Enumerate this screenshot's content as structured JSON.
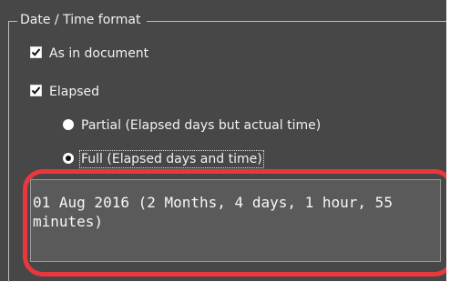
{
  "group": {
    "title": "Date / Time format"
  },
  "options": {
    "as_in_document": {
      "label": "As in document",
      "checked": true
    },
    "elapsed": {
      "label": "Elapsed",
      "checked": true
    },
    "partial": {
      "label": "Partial (Elapsed days but actual time)",
      "selected": false
    },
    "full": {
      "label": "Full (Elapsed days and time)",
      "selected": true
    }
  },
  "preview": {
    "text": "01 Aug 2016 (2 Months, 4 days, 1 hour, 55 minutes)"
  },
  "colors": {
    "panel_bg": "#474747",
    "highlight": "#e8383d"
  },
  "icons": [
    "checkmark-icon",
    "radio-selected-icon",
    "radio-unselected-icon"
  ]
}
